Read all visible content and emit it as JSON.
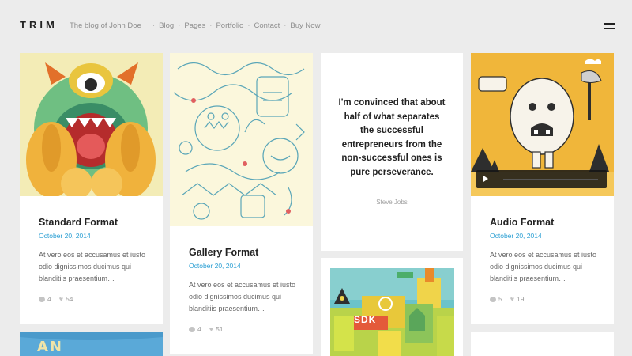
{
  "header": {
    "logo": "TRIM",
    "tagline": "The blog of John Doe",
    "nav": [
      "Blog",
      "Pages",
      "Portfolio",
      "Contact",
      "Buy Now"
    ],
    "separator": "·"
  },
  "posts": [
    {
      "title": "Standard Format",
      "date": "October 20, 2014",
      "excerpt": "At vero eos et accusamus et iusto odio dignissimos ducimus qui blanditiis praesentium…",
      "comments": "4",
      "likes": "54"
    },
    {
      "title": "Gallery Format",
      "date": "October 20, 2014",
      "excerpt": "At vero eos et accusamus et iusto odio dignissimos ducimus qui blanditiis praesentium…",
      "comments": "4",
      "likes": "51"
    },
    {
      "quote": "I'm convinced that about half of what separates the successful entrepreneurs from the non-successful ones is pure perseverance.",
      "author": "Steve Jobs"
    },
    {
      "title": "Audio Format",
      "date": "October 20, 2014",
      "excerpt": "At vero eos et accusamus et iusto odio dignissimos ducimus qui blanditiis praesentium…",
      "comments": "5",
      "likes": "19"
    }
  ],
  "partial": {
    "sdk_label": "SDK",
    "blue_text": "AN"
  },
  "icons": {
    "comment": "comment-icon",
    "like": "heart-icon",
    "menu": "menu-icon",
    "play": "play-icon"
  },
  "colors": {
    "accent": "#2b9fd3",
    "background": "#ececec"
  }
}
